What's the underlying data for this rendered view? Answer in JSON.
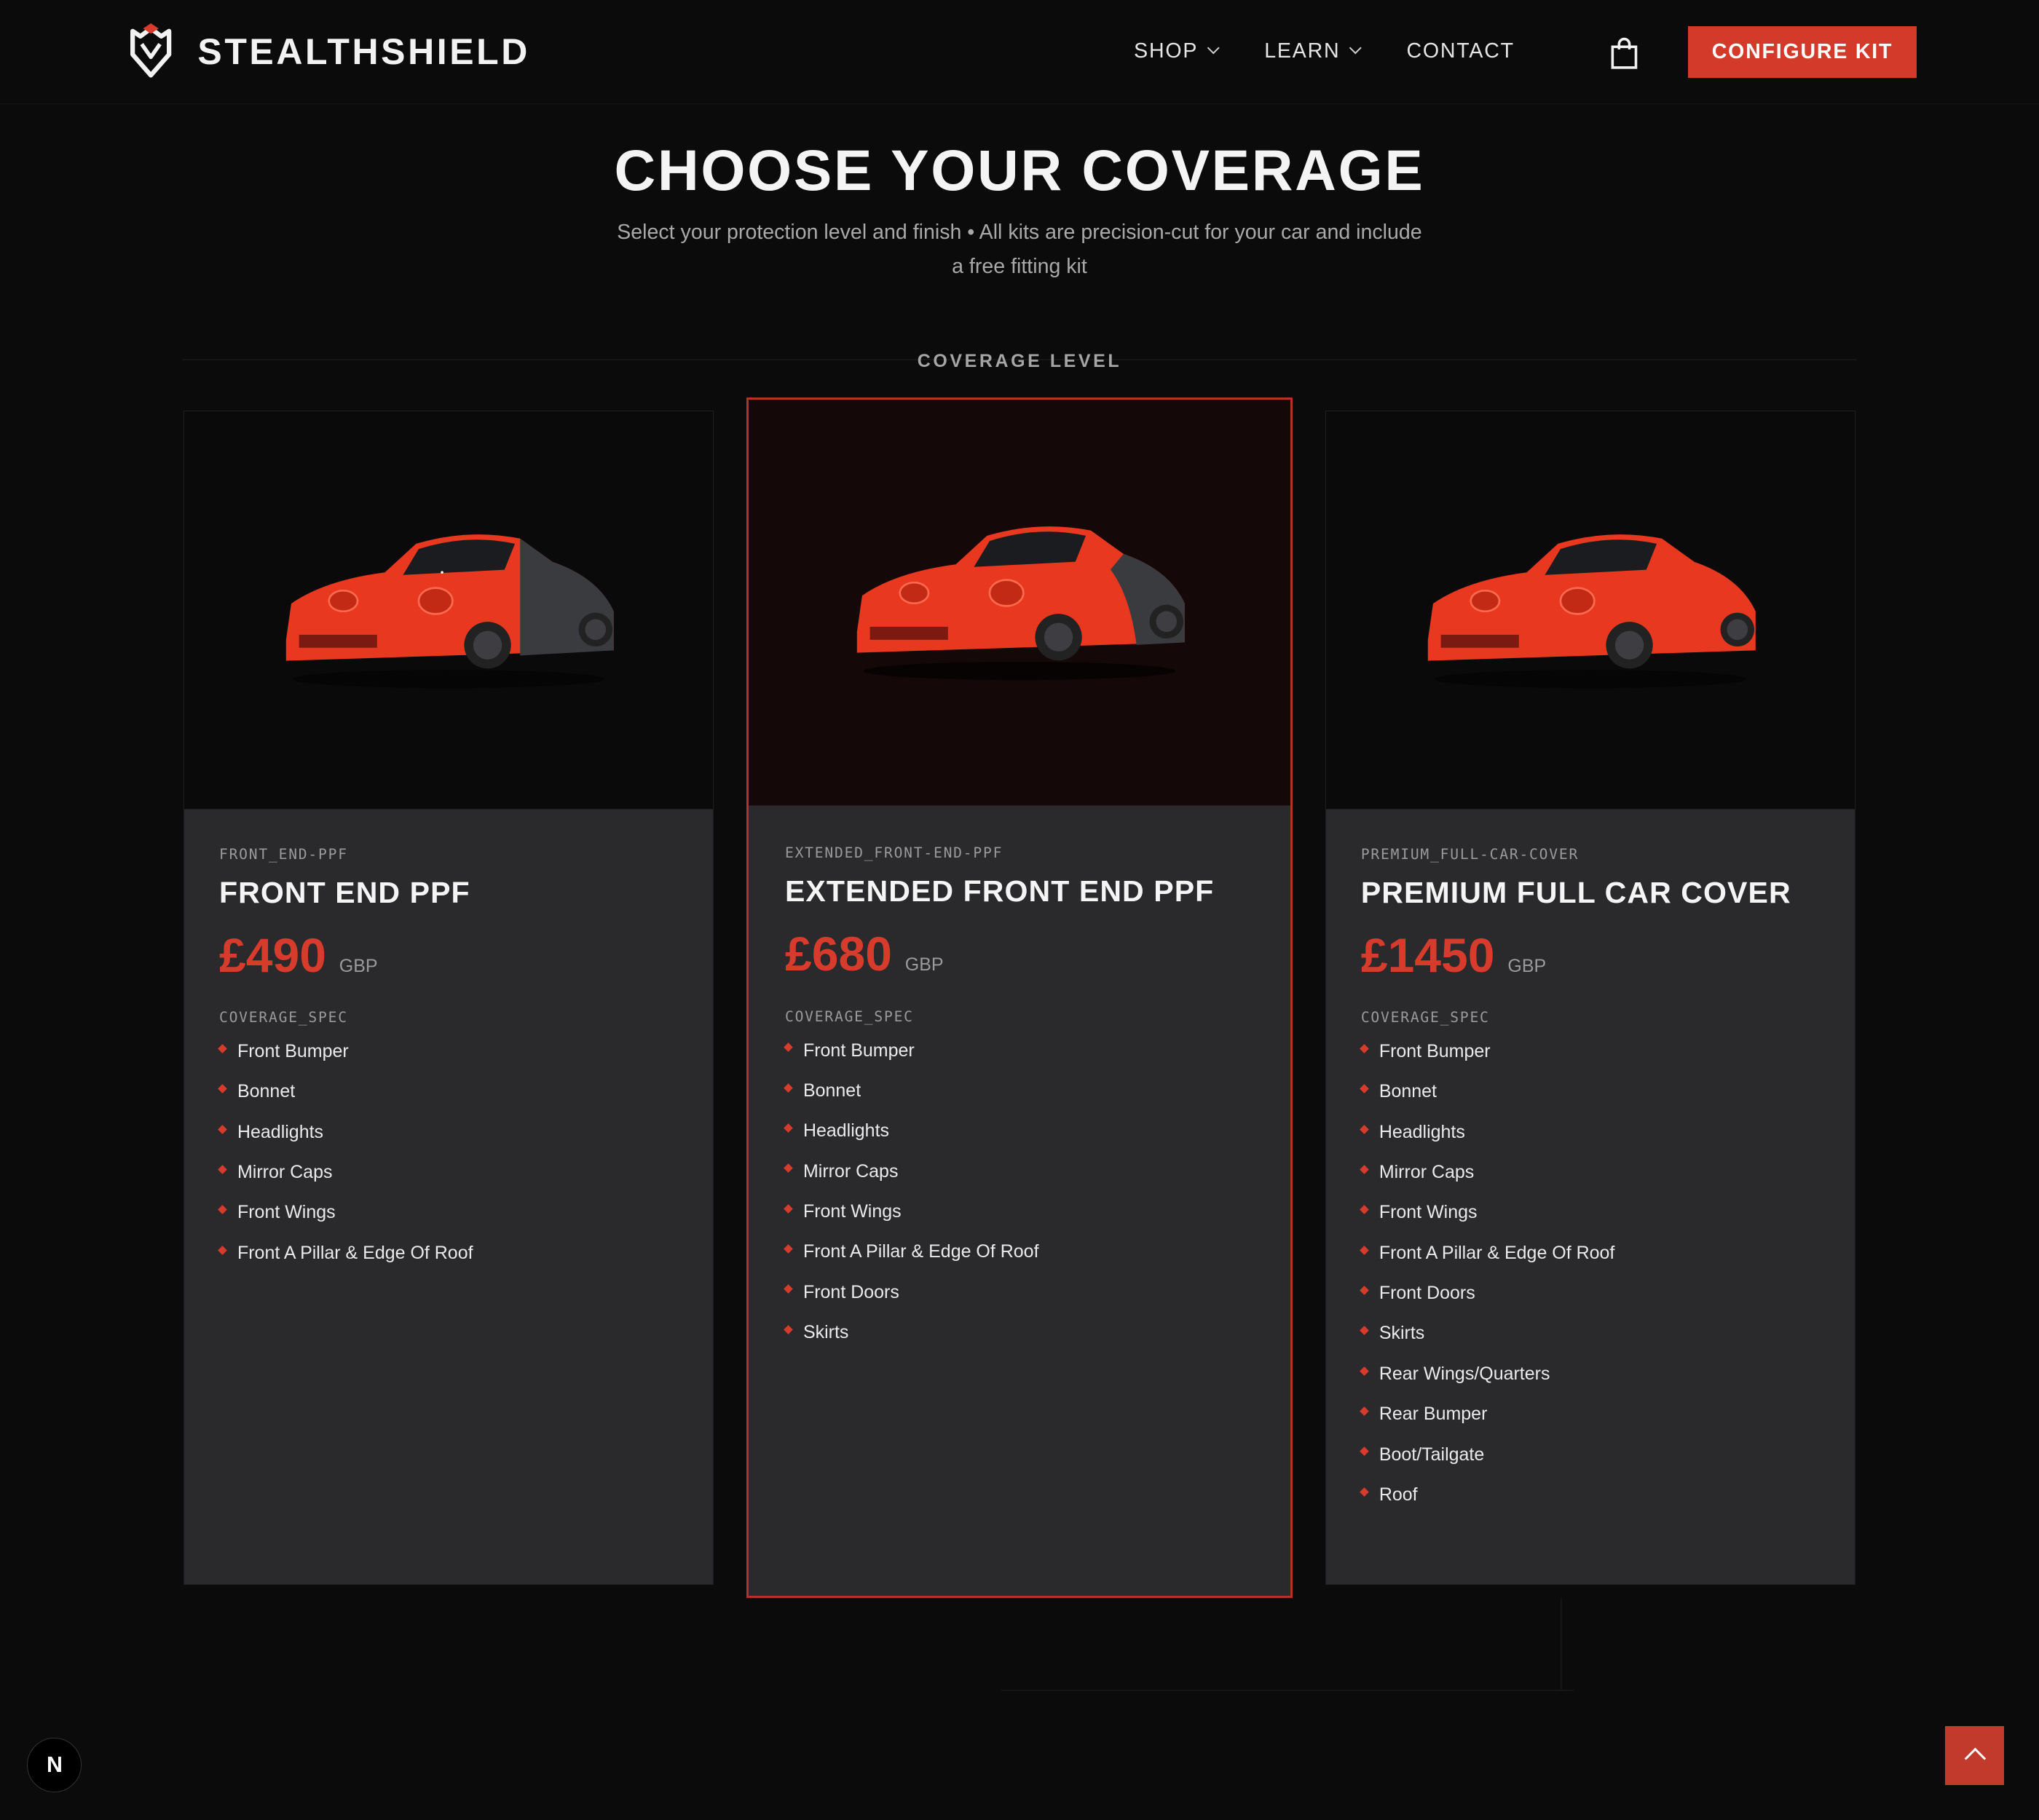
{
  "nav": {
    "brand": "STEALTHSHIELD",
    "logo_icon": "shield-logo-icon",
    "menu": [
      {
        "label": "SHOP",
        "has_dropdown": true
      },
      {
        "label": "LEARN",
        "has_dropdown": true
      },
      {
        "label": "CONTACT",
        "has_dropdown": false
      }
    ],
    "cart_icon": "shopping-bag-icon",
    "cta_label": "CONFIGURE KIT"
  },
  "header": {
    "title": "CHOOSE YOUR COVERAGE",
    "subtitle": "Select your protection level and finish • All kits are precision-cut for your car and include a free fitting kit"
  },
  "section_label": "COVERAGE LEVEL",
  "colors": {
    "accent": "#d63b2b",
    "background": "#0b0b0c",
    "card": "#2a2a2d"
  },
  "cards": [
    {
      "code": "FRONT_END-PPF",
      "name": "FRONT END PPF",
      "price": "£490",
      "currency": "GBP",
      "spec_label": "COVERAGE_SPEC",
      "selected": false,
      "items": [
        "Front Bumper",
        "Bonnet",
        "Headlights",
        "Mirror Caps",
        "Front Wings",
        "Front A Pillar & Edge Of Roof"
      ]
    },
    {
      "code": "EXTENDED_FRONT-END-PPF",
      "name": "EXTENDED FRONT END PPF",
      "price": "£680",
      "currency": "GBP",
      "spec_label": "COVERAGE_SPEC",
      "selected": true,
      "items": [
        "Front Bumper",
        "Bonnet",
        "Headlights",
        "Mirror Caps",
        "Front Wings",
        "Front A Pillar & Edge Of Roof",
        "Front Doors",
        "Skirts"
      ]
    },
    {
      "code": "PREMIUM_FULL-CAR-COVER",
      "name": "PREMIUM FULL CAR COVER",
      "price": "£1450",
      "currency": "GBP",
      "spec_label": "COVERAGE_SPEC",
      "selected": false,
      "items": [
        "Front Bumper",
        "Bonnet",
        "Headlights",
        "Mirror Caps",
        "Front Wings",
        "Front A Pillar & Edge Of Roof",
        "Front Doors",
        "Skirts",
        "Rear Wings/Quarters",
        "Rear Bumper",
        "Boot/Tailgate",
        "Roof"
      ]
    }
  ],
  "devtools_badge": "N",
  "scroll_top_icon": "chevron-up-icon"
}
